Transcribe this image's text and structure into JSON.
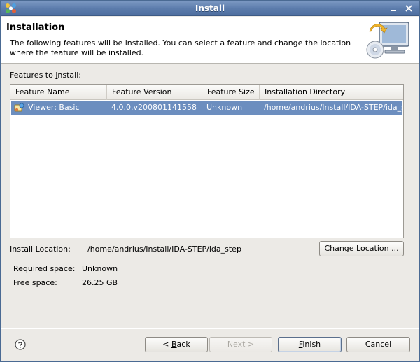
{
  "window": {
    "title": "Install"
  },
  "banner": {
    "title": "Installation",
    "description": "The following features will be installed. You can select a feature and change the location where the feature will be installed."
  },
  "features_label_pre": "Features to ",
  "features_label_mnemonic": "i",
  "features_label_post": "nstall:",
  "table": {
    "columns": [
      "Feature Name",
      "Feature Version",
      "Feature Size",
      "Installation Directory"
    ],
    "rows": [
      [
        "Viewer: Basic",
        "4.0.0.v200801141558",
        "Unknown",
        "/home/andrius/Install/IDA-STEP/ida_step"
      ]
    ]
  },
  "install_location": {
    "label": "Install Location:",
    "value": "/home/andrius/Install/IDA-STEP/ida_step",
    "change_button": "Change Location ..."
  },
  "space": {
    "required_label": "Required space:",
    "required_value": "Unknown",
    "free_label": "Free space:",
    "free_value": "26.25 GB"
  },
  "buttons": {
    "back_pre": "< ",
    "back_mnemonic": "B",
    "back_post": "ack",
    "next": "Next >",
    "finish_mnemonic": "F",
    "finish_post": "inish",
    "cancel": "Cancel"
  },
  "icons": {
    "app": "app-logo-icon",
    "banner": "install-computer-cd-icon",
    "feature": "feature-plugin-icon",
    "help": "help-icon"
  },
  "colors": {
    "titlebar": "#5b7bab",
    "selection": "#6c8ebf"
  }
}
